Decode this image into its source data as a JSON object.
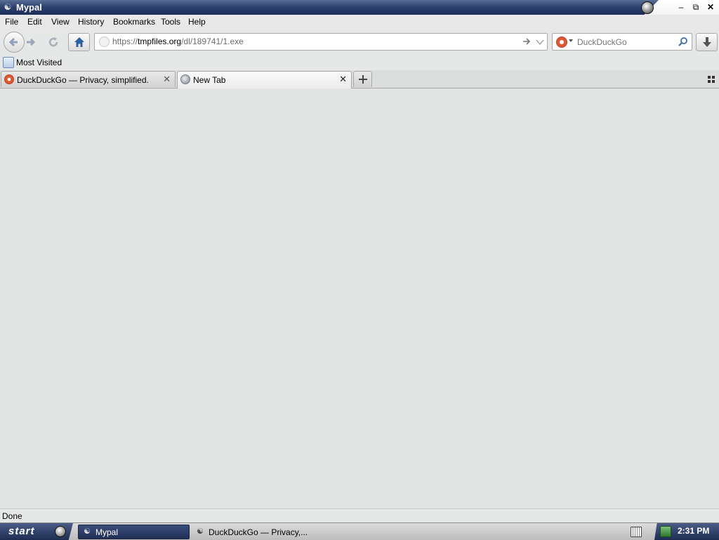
{
  "window": {
    "title": "Mypal"
  },
  "menu": [
    "File",
    "Edit",
    "View",
    "History",
    "Bookmarks",
    "Tools",
    "Help"
  ],
  "url": {
    "prefix": "https://",
    "domain": "tmpfiles.org",
    "path": "/dl/189741/1.exe"
  },
  "search": {
    "engine": "DuckDuckGo",
    "placeholder": "DuckDuckGo"
  },
  "bookmarks": {
    "most_visited": "Most Visited"
  },
  "tabs": [
    {
      "label": "DuckDuckGo — Privacy, simplified.",
      "selected": false
    },
    {
      "label": "New Tab",
      "selected": true
    }
  ],
  "status": {
    "text": "Done"
  },
  "taskbar": {
    "start_label": "start",
    "tasks": [
      "Mypal",
      "DuckDuckGo — Privacy,..."
    ],
    "clock": "2:31 PM"
  },
  "colors": {
    "title_dark": "#1b2c55",
    "accent_ddg": "#de5833"
  },
  "icons": [
    "back-icon",
    "forward-icon",
    "reload-icon",
    "home-icon",
    "go-arrow-icon",
    "dropdown-icon",
    "search-icon",
    "download-icon",
    "new-tab-icon",
    "tab-list-icon"
  ]
}
